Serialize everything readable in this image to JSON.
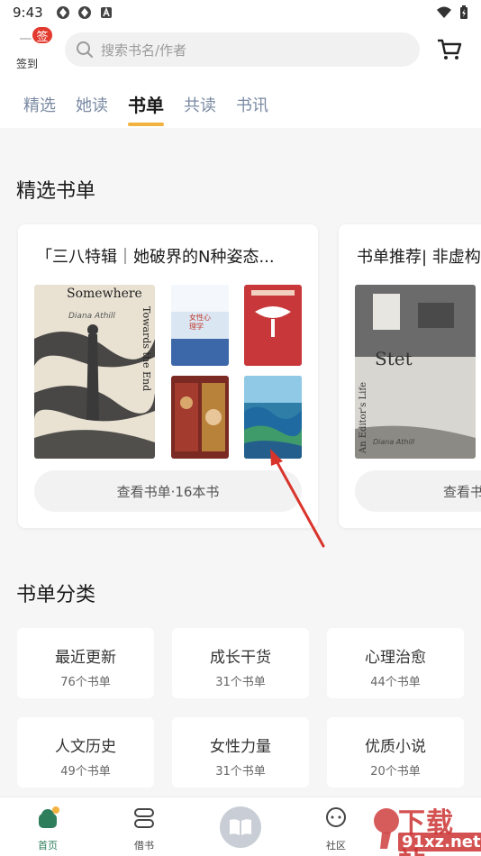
{
  "status": {
    "time": "9:43"
  },
  "header": {
    "signin_badge": "签",
    "signin_label": "签到",
    "search_placeholder": "搜索书名/作者"
  },
  "tabs": [
    {
      "label": "精选"
    },
    {
      "label": "她读"
    },
    {
      "label": "书单",
      "active": true
    },
    {
      "label": "共读"
    },
    {
      "label": "书讯"
    }
  ],
  "featured": {
    "title": "精选书单",
    "cards": [
      {
        "title": "「三八特辑｜她破界的N种姿态...",
        "button": "查看书单·16本书",
        "books": [
          {
            "cover_title": "Somewhere",
            "cover_subtitle": "Towards the End",
            "author": "Diana Athill",
            "color": "#e9e2d3"
          },
          {
            "cover_title": "女性心理学",
            "color": "#dbe6f3"
          },
          {
            "cover_title": "",
            "color": "#c8383a"
          },
          {
            "cover_title": "",
            "color": "#7a2a22"
          },
          {
            "cover_title": "",
            "color": "#2f7ea8"
          }
        ]
      },
      {
        "title": "书单推荐| 非虚构",
        "button": "查看书",
        "books": [
          {
            "cover_title": "Stet",
            "cover_subtitle": "An Editor's Life",
            "author": "Diana Athill",
            "color": "#d8d6d0"
          }
        ]
      }
    ]
  },
  "categories": {
    "title": "书单分类",
    "items": [
      {
        "name": "最近更新",
        "count": "76个书单"
      },
      {
        "name": "成长干货",
        "count": "31个书单"
      },
      {
        "name": "心理治愈",
        "count": "44个书单"
      },
      {
        "name": "人文历史",
        "count": "49个书单"
      },
      {
        "name": "女性力量",
        "count": "31个书单"
      },
      {
        "name": "优质小说",
        "count": "20个书单"
      }
    ]
  },
  "bottom_nav": [
    {
      "label": "首页",
      "icon": "home-icon",
      "active": true
    },
    {
      "label": "借书",
      "icon": "borrow-icon"
    },
    {
      "label": "",
      "icon": "open-book-icon"
    },
    {
      "label": "社区",
      "icon": "community-icon"
    }
  ],
  "watermark": {
    "main": "下载站",
    "sub": "91xz.net"
  },
  "colors": {
    "accent": "#f1b23f",
    "badge": "#e23a2e",
    "nav_active": "#2e7d5b"
  }
}
